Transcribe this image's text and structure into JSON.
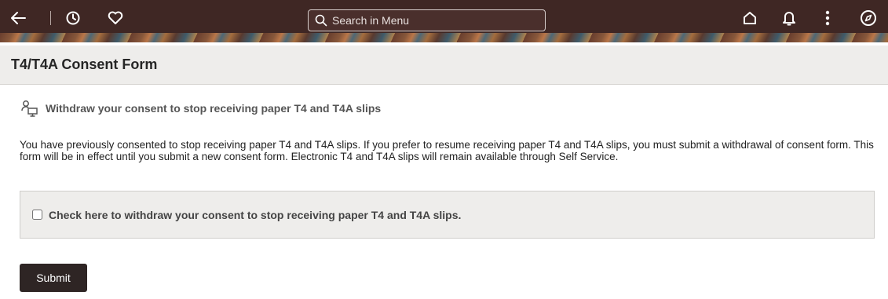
{
  "header": {
    "search_placeholder": "Search in Menu",
    "icons": [
      "back-arrow-icon",
      "history-icon",
      "favorites-heart-icon",
      "search-icon",
      "home-icon",
      "notifications-bell-icon",
      "more-vertical-icon",
      "navigator-compass-icon"
    ],
    "colors": {
      "bar": "#3f2724",
      "icon": "#ffffff"
    }
  },
  "page": {
    "title": "T4/T4A Consent Form"
  },
  "section": {
    "heading": "Withdraw your consent to stop receiving paper T4 and T4A slips",
    "icon": "person-computer-icon",
    "body": "You have previously consented to stop receiving paper T4 and T4A slips. If you prefer to resume receiving paper T4 and T4A slips, you must submit a withdrawal of consent form. This form will be in effect until you submit a new consent form. Electronic T4 and T4A slips will remain available through Self Service."
  },
  "consent": {
    "checkbox_label": "Check here to withdraw your consent to stop receiving paper T4 and T4A slips.",
    "checked": false
  },
  "actions": {
    "submit_label": "Submit"
  }
}
